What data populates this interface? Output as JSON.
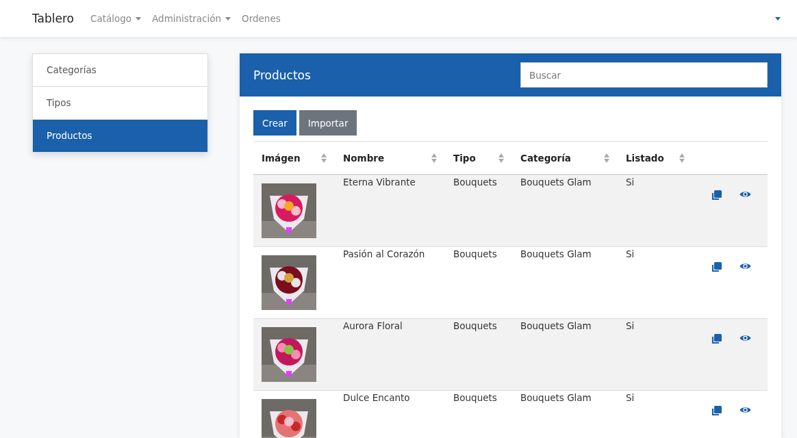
{
  "navbar": {
    "brand": "Tablero",
    "items": [
      {
        "label": "Catálogo",
        "dropdown": true
      },
      {
        "label": "Administración",
        "dropdown": true
      },
      {
        "label": "Ordenes",
        "dropdown": false
      }
    ],
    "user_menu": {
      "dropdown": true
    }
  },
  "sidebar": {
    "items": [
      {
        "label": "Categorías",
        "selected": false
      },
      {
        "label": "Tipos",
        "selected": false
      },
      {
        "label": "Productos",
        "selected": true
      }
    ]
  },
  "panel": {
    "title": "Productos",
    "search": {
      "placeholder": "Buscar"
    },
    "buttons": [
      {
        "label": "Crear",
        "kind": "primary"
      },
      {
        "label": "Importar",
        "kind": "secondary"
      }
    ],
    "table": {
      "columns": [
        "Imágen",
        "Nombre",
        "Tipo",
        "Categoría",
        "Listado"
      ],
      "rows": [
        {
          "name": "Eterna Vibrante",
          "type": "Bouquets",
          "category": "Bouquets Glam",
          "listed": "Si"
        },
        {
          "name": "Pasión al Corazón",
          "type": "Bouquets",
          "category": "Bouquets Glam",
          "listed": "Si"
        },
        {
          "name": "Aurora Floral",
          "type": "Bouquets",
          "category": "Bouquets Glam",
          "listed": "Si"
        },
        {
          "name": "Dulce Encanto",
          "type": "Bouquets",
          "category": "Bouquets Glam",
          "listed": "Si"
        }
      ]
    }
  }
}
